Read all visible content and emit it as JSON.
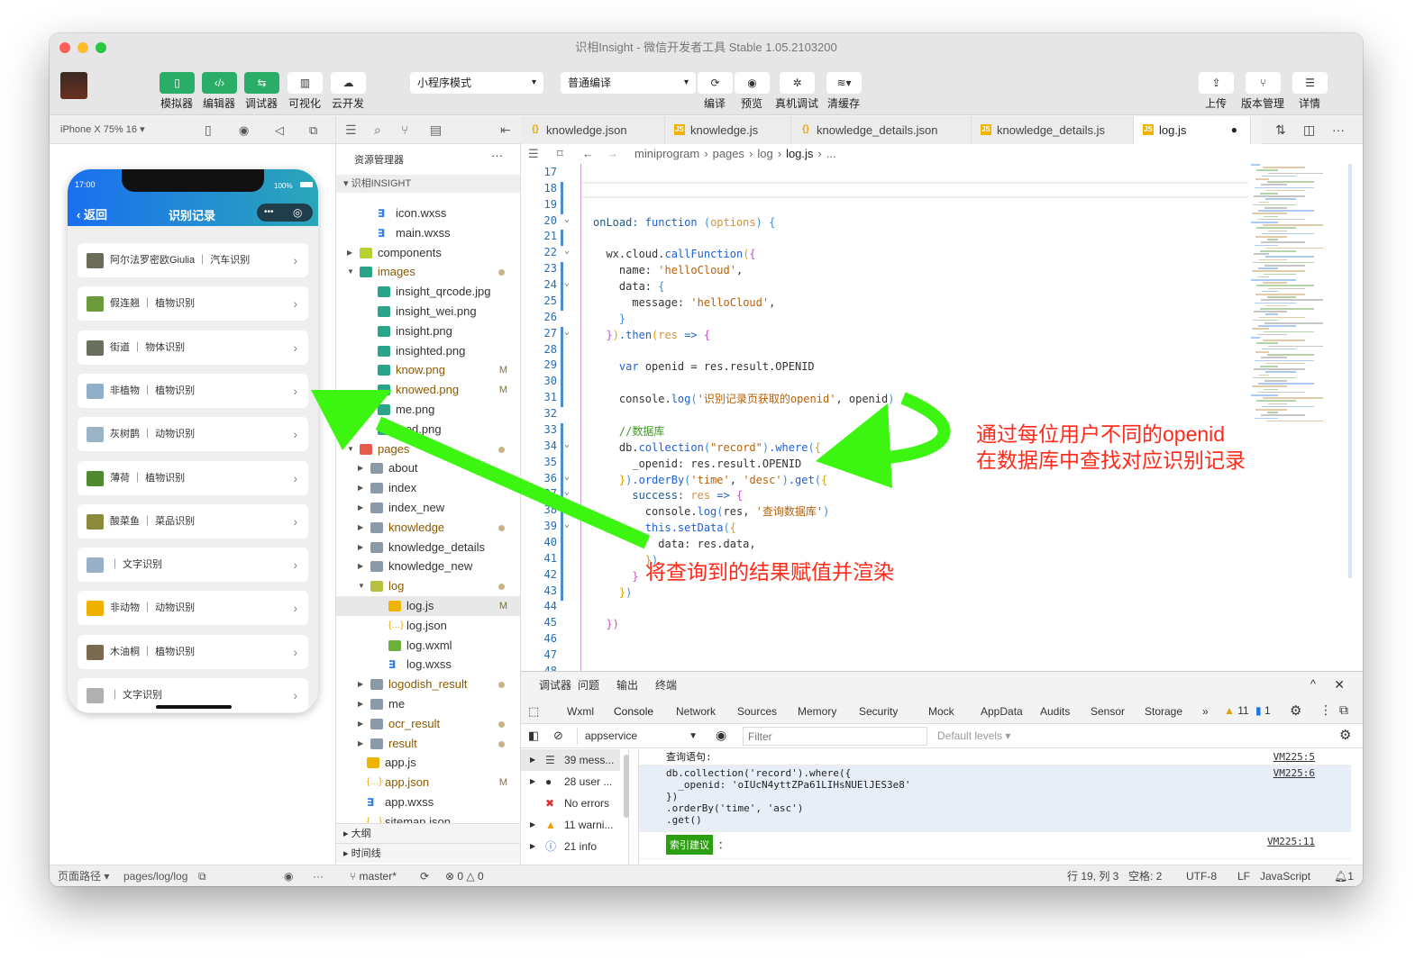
{
  "window": {
    "title": "识相Insight - 微信开发者工具 Stable 1.05.2103200"
  },
  "toolbar": {
    "left_buttons": [
      {
        "label": "模拟器",
        "icon": "phone-icon"
      },
      {
        "label": "编辑器",
        "icon": "code-icon"
      },
      {
        "label": "调试器",
        "icon": "debug-icon"
      },
      {
        "label": "可视化",
        "icon": "layout-icon"
      },
      {
        "label": "云开发",
        "icon": "cloud-icon"
      }
    ],
    "mode_select": "小程序模式",
    "compile_select": "普通编译",
    "mid_buttons": [
      {
        "label": "编译",
        "icon": "refresh-icon"
      },
      {
        "label": "预览",
        "icon": "eye-icon"
      },
      {
        "label": "真机调试",
        "icon": "bug-icon"
      },
      {
        "label": "清缓存",
        "icon": "layers-icon"
      }
    ],
    "right_buttons": [
      {
        "label": "上传",
        "icon": "upload-icon"
      },
      {
        "label": "版本管理",
        "icon": "branch-icon"
      },
      {
        "label": "详情",
        "icon": "menu-icon"
      }
    ]
  },
  "simulator": {
    "device": "iPhone X 75% 16 ▾",
    "status_time": "17:00",
    "battery": "100%",
    "back": "返回",
    "title": "识别记录",
    "items": [
      {
        "label": "阿尔法罗密欧Giulia ｜ 汽车识别",
        "thumb": "#6b6b5a"
      },
      {
        "label": "假连翘 ｜ 植物识别",
        "thumb": "#6a9a3a"
      },
      {
        "label": "街道 ｜ 物体识别",
        "thumb": "#6a7060"
      },
      {
        "label": "非植物 ｜ 植物识别",
        "thumb": "#8fb0c8"
      },
      {
        "label": "灰树鹊 ｜ 动物识别",
        "thumb": "#9ab4c6"
      },
      {
        "label": "薄荷 ｜ 植物识别",
        "thumb": "#4f8a2f"
      },
      {
        "label": "酸菜鱼 ｜ 菜品识别",
        "thumb": "#8a8a3a"
      },
      {
        "label": "｜ 文字识别",
        "thumb": "#9ab0c8"
      },
      {
        "label": "非动物 ｜ 动物识别",
        "thumb": "#f0b000"
      },
      {
        "label": "木油桐 ｜ 植物识别",
        "thumb": "#7a6a50"
      },
      {
        "label": "｜ 文字识别",
        "thumb": "#b0b0b0"
      }
    ],
    "footer_path_label": "页面路径 ▾",
    "footer_path": "pages/log/log"
  },
  "explorer": {
    "title": "资源管理器",
    "project": "识相INSIGHT",
    "items": [
      {
        "name": "icon.wxss",
        "d": 2,
        "t": "wxss"
      },
      {
        "name": "main.wxss",
        "d": 2,
        "t": "wxss"
      },
      {
        "name": "components",
        "d": 1,
        "t": "folder-c",
        "arrow": "closed"
      },
      {
        "name": "images",
        "d": 1,
        "t": "folder-i",
        "arrow": "open",
        "mod": true,
        "dot": true
      },
      {
        "name": "insight_qrcode.jpg",
        "d": 2,
        "t": "img"
      },
      {
        "name": "insight_wei.png",
        "d": 2,
        "t": "img"
      },
      {
        "name": "insight.png",
        "d": 2,
        "t": "img"
      },
      {
        "name": "insighted.png",
        "d": 2,
        "t": "img"
      },
      {
        "name": "know.png",
        "d": 2,
        "t": "img",
        "mod": true,
        "badge": "M"
      },
      {
        "name": "knowed.png",
        "d": 2,
        "t": "img",
        "mod": true,
        "badge": "M"
      },
      {
        "name": "me.png",
        "d": 2,
        "t": "img"
      },
      {
        "name": "med.png",
        "d": 2,
        "t": "img"
      },
      {
        "name": "pages",
        "d": 1,
        "t": "folder-p",
        "arrow": "open",
        "mod": true,
        "dot": true
      },
      {
        "name": "about",
        "d": 2,
        "t": "folder",
        "arrow": "closed"
      },
      {
        "name": "index",
        "d": 2,
        "t": "folder",
        "arrow": "closed"
      },
      {
        "name": "index_new",
        "d": 2,
        "t": "folder",
        "arrow": "closed"
      },
      {
        "name": "knowledge",
        "d": 2,
        "t": "folder",
        "arrow": "closed",
        "mod": true,
        "dot": true
      },
      {
        "name": "knowledge_details",
        "d": 2,
        "t": "folder",
        "arrow": "closed"
      },
      {
        "name": "knowledge_new",
        "d": 2,
        "t": "folder",
        "arrow": "closed"
      },
      {
        "name": "log",
        "d": 2,
        "t": "folder-l",
        "arrow": "open",
        "mod": true,
        "dot": true
      },
      {
        "name": "log.js",
        "d": 3,
        "t": "js",
        "badge": "M",
        "sel": true
      },
      {
        "name": "log.json",
        "d": 3,
        "t": "json"
      },
      {
        "name": "log.wxml",
        "d": 3,
        "t": "wxml"
      },
      {
        "name": "log.wxss",
        "d": 3,
        "t": "wxss"
      },
      {
        "name": "logodish_result",
        "d": 2,
        "t": "folder",
        "arrow": "closed",
        "mod": true,
        "dot": true
      },
      {
        "name": "me",
        "d": 2,
        "t": "folder",
        "arrow": "closed"
      },
      {
        "name": "ocr_result",
        "d": 2,
        "t": "folder",
        "arrow": "closed",
        "mod": true,
        "dot": true
      },
      {
        "name": "result",
        "d": 2,
        "t": "folder",
        "arrow": "closed",
        "mod": true,
        "dot": true
      },
      {
        "name": "app.js",
        "d": 1,
        "t": "js"
      },
      {
        "name": "app.json",
        "d": 1,
        "t": "json",
        "mod": true,
        "badge": "M"
      },
      {
        "name": "app.wxss",
        "d": 1,
        "t": "wxss"
      },
      {
        "name": "sitemap.json",
        "d": 1,
        "t": "json"
      }
    ],
    "sections": [
      "大纲",
      "时间线"
    ]
  },
  "editor": {
    "tabs": [
      {
        "label": "knowledge.json",
        "type": "json"
      },
      {
        "label": "knowledge.js",
        "type": "js"
      },
      {
        "label": "knowledge_details.json",
        "type": "json"
      },
      {
        "label": "knowledge_details.js",
        "type": "js"
      },
      {
        "label": "log.js",
        "type": "js",
        "active": true
      }
    ],
    "breadcrumb": [
      "miniprogram",
      "pages",
      "log",
      "log.js",
      "..."
    ],
    "first_line": 17,
    "lines": [
      [],
      [],
      [],
      [
        [
          0,
          ""
        ],
        [
          "onLoad: ",
          "p"
        ],
        [
          "function ",
          "k"
        ],
        [
          "(",
          "b3"
        ],
        [
          "options",
          "o"
        ],
        [
          ") ",
          "b3"
        ],
        [
          "{",
          "b3"
        ]
      ],
      [],
      [
        [
          2,
          ""
        ],
        [
          "wx.cloud.",
          "t"
        ],
        [
          "callFunction",
          "f"
        ],
        [
          "(",
          "b1"
        ],
        [
          "{",
          "b2"
        ]
      ],
      [
        [
          4,
          ""
        ],
        [
          "name: ",
          "t"
        ],
        [
          "'helloCloud'",
          "s"
        ],
        [
          ",",
          "t"
        ]
      ],
      [
        [
          4,
          ""
        ],
        [
          "data: ",
          "t"
        ],
        [
          "{",
          "b3"
        ]
      ],
      [
        [
          6,
          ""
        ],
        [
          "message: ",
          "t"
        ],
        [
          "'helloCloud'",
          "s"
        ],
        [
          ",",
          "t"
        ]
      ],
      [
        [
          4,
          ""
        ],
        [
          "}",
          "b3"
        ]
      ],
      [
        [
          2,
          ""
        ],
        [
          "}",
          "b2"
        ],
        [
          ")",
          "b1"
        ],
        [
          ".then",
          "f"
        ],
        [
          "(",
          "b1"
        ],
        [
          "res ",
          "o"
        ],
        [
          "=> ",
          "k"
        ],
        [
          "{",
          "b2"
        ]
      ],
      [],
      [
        [
          4,
          ""
        ],
        [
          "var ",
          "k"
        ],
        [
          "openid = res.result.OPENID",
          "t"
        ]
      ],
      [],
      [
        [
          4,
          ""
        ],
        [
          "console.",
          "t"
        ],
        [
          "log",
          "f"
        ],
        [
          "(",
          "b3"
        ],
        [
          "'识别记录页获取的openid'",
          "s"
        ],
        [
          ", openid",
          "t"
        ],
        [
          ")",
          "b3"
        ]
      ],
      [],
      [
        [
          4,
          ""
        ],
        [
          "//数据库",
          "c"
        ]
      ],
      [
        [
          4,
          ""
        ],
        [
          "db.",
          "t"
        ],
        [
          "collection",
          "f"
        ],
        [
          "(",
          "b3"
        ],
        [
          "\"record\"",
          "s"
        ],
        [
          ")",
          "b3"
        ],
        [
          ".where",
          "f"
        ],
        [
          "(",
          "b3"
        ],
        [
          "{",
          "b1"
        ]
      ],
      [
        [
          6,
          ""
        ],
        [
          "_openid: res.result.OPENID",
          "t"
        ]
      ],
      [
        [
          4,
          ""
        ],
        [
          "}",
          "b1"
        ],
        [
          ")",
          "b3"
        ],
        [
          ".orderBy",
          "f"
        ],
        [
          "(",
          "b3"
        ],
        [
          "'time'",
          "s"
        ],
        [
          ", ",
          "t"
        ],
        [
          "'desc'",
          "s"
        ],
        [
          ")",
          "b3"
        ],
        [
          ".get",
          "f"
        ],
        [
          "(",
          "b3"
        ],
        [
          "{",
          "b1"
        ]
      ],
      [
        [
          6,
          ""
        ],
        [
          "success: ",
          "p"
        ],
        [
          "res ",
          "o"
        ],
        [
          "=> ",
          "k"
        ],
        [
          "{",
          "b2"
        ]
      ],
      [
        [
          8,
          ""
        ],
        [
          "console.",
          "t"
        ],
        [
          "log",
          "f"
        ],
        [
          "(",
          "b3"
        ],
        [
          "res, ",
          "t"
        ],
        [
          "'查询数据库'",
          "s"
        ],
        [
          ")",
          "b3"
        ]
      ],
      [
        [
          8,
          ""
        ],
        [
          "this",
          "k"
        ],
        [
          ".setData",
          "f"
        ],
        [
          "(",
          "b3"
        ],
        [
          "{",
          "b1"
        ]
      ],
      [
        [
          10,
          ""
        ],
        [
          "data: res.data,",
          "t"
        ]
      ],
      [
        [
          8,
          ""
        ],
        [
          "}",
          "b1"
        ],
        [
          ")",
          "b3"
        ]
      ],
      [
        [
          6,
          ""
        ],
        [
          "}",
          "b2"
        ]
      ],
      [
        [
          4,
          ""
        ],
        [
          "}",
          "b1"
        ],
        [
          ")",
          "b3"
        ]
      ],
      [],
      [
        [
          2,
          ""
        ],
        [
          "})",
          "b2"
        ]
      ],
      [],
      [],
      []
    ]
  },
  "annotations": {
    "right": [
      "通过每位用户不同的openid",
      "在数据库中查找对应识别记录"
    ],
    "bottom": "将查询到的结果赋值并渲染",
    "color": "#ff2a1a",
    "arrow_color": "#3cf511"
  },
  "debugger": {
    "top_tabs": [
      "调试器",
      "问题",
      "输出",
      "终端"
    ],
    "tabs": [
      "Wxml",
      "Console",
      "Network",
      "Sources",
      "Memory",
      "Security",
      "Mock",
      "AppData",
      "Audits",
      "Sensor",
      "Storage",
      "»"
    ],
    "active_tab": "Console",
    "warnings": "11",
    "info_count": "1",
    "context": "appservice",
    "filter_placeholder": "Filter",
    "levels": "Default levels ▾",
    "sidebar": [
      {
        "label": "39 mess...",
        "icon": "list-icon"
      },
      {
        "label": "28 user ...",
        "icon": "user-icon"
      },
      {
        "label": "No errors",
        "icon": "error-icon"
      },
      {
        "label": "11 warni...",
        "icon": "warning-icon"
      },
      {
        "label": "21 info",
        "icon": "info-icon"
      }
    ],
    "messages": [
      {
        "text": "查询语句:",
        "src": "VM225:5"
      },
      {
        "text": "db.collection('record').where({\n  _openid: 'oIUcN4yttZPa61LIHsNUElJES3e8'\n})\n.orderBy('time', 'asc')\n.get()",
        "src": "VM225:6"
      },
      {
        "badge": "索引建议",
        "text": "：",
        "src": "VM225:11"
      }
    ]
  },
  "statusbar": {
    "branch": "master*",
    "errors": "0",
    "warnings": "0",
    "position": "行 19, 列 3",
    "spaces": "空格: 2",
    "encoding": "UTF-8",
    "eol": "LF",
    "language": "JavaScript",
    "notifications": "1"
  }
}
